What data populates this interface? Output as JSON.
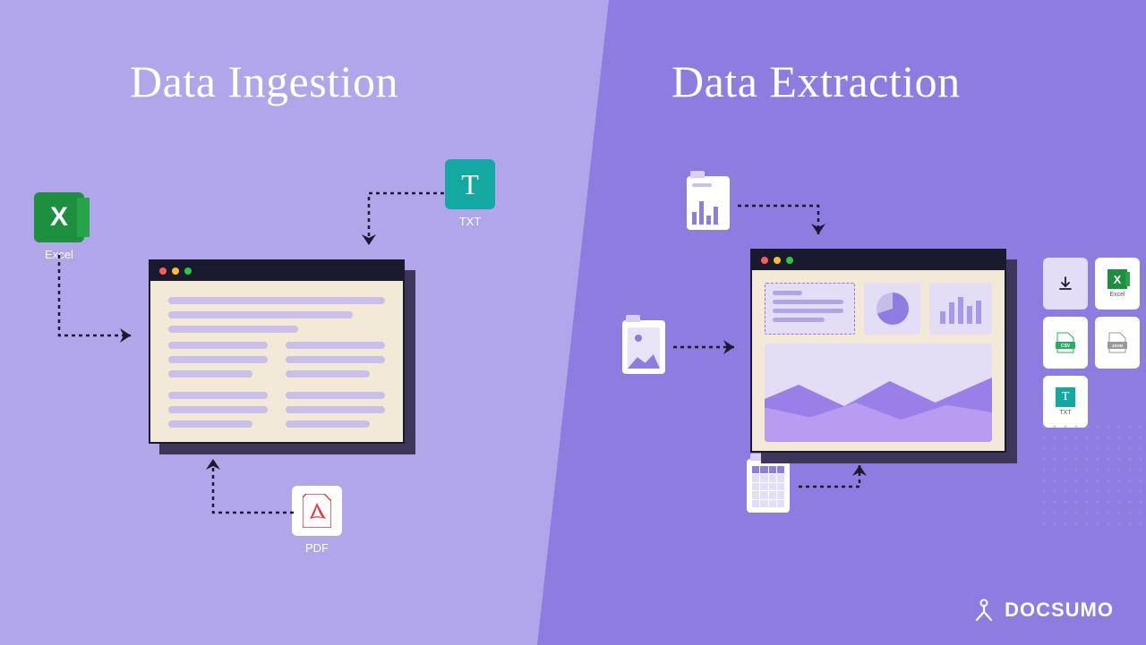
{
  "titles": {
    "left": "Data Ingestion",
    "right": "Data Extraction"
  },
  "ingestion_sources": {
    "excel": {
      "label": "Excel",
      "color": "#1d8f3e"
    },
    "txt": {
      "label": "TXT",
      "color": "#14a8a3"
    },
    "pdf": {
      "label": "PDF",
      "bg": "#ffffff",
      "accent": "#e63946"
    }
  },
  "extraction_outputs": {
    "download": {
      "label": "",
      "icon": "download"
    },
    "excel": {
      "label": "Excel",
      "icon": "excel",
      "color": "#1d8f3e"
    },
    "csv": {
      "label": "CSV",
      "color": "#27ae60"
    },
    "json": {
      "label": "JSON",
      "color": "#999999"
    },
    "txt": {
      "label": "TXT",
      "color": "#14a8a3"
    }
  },
  "brand": "DOCSUMO"
}
